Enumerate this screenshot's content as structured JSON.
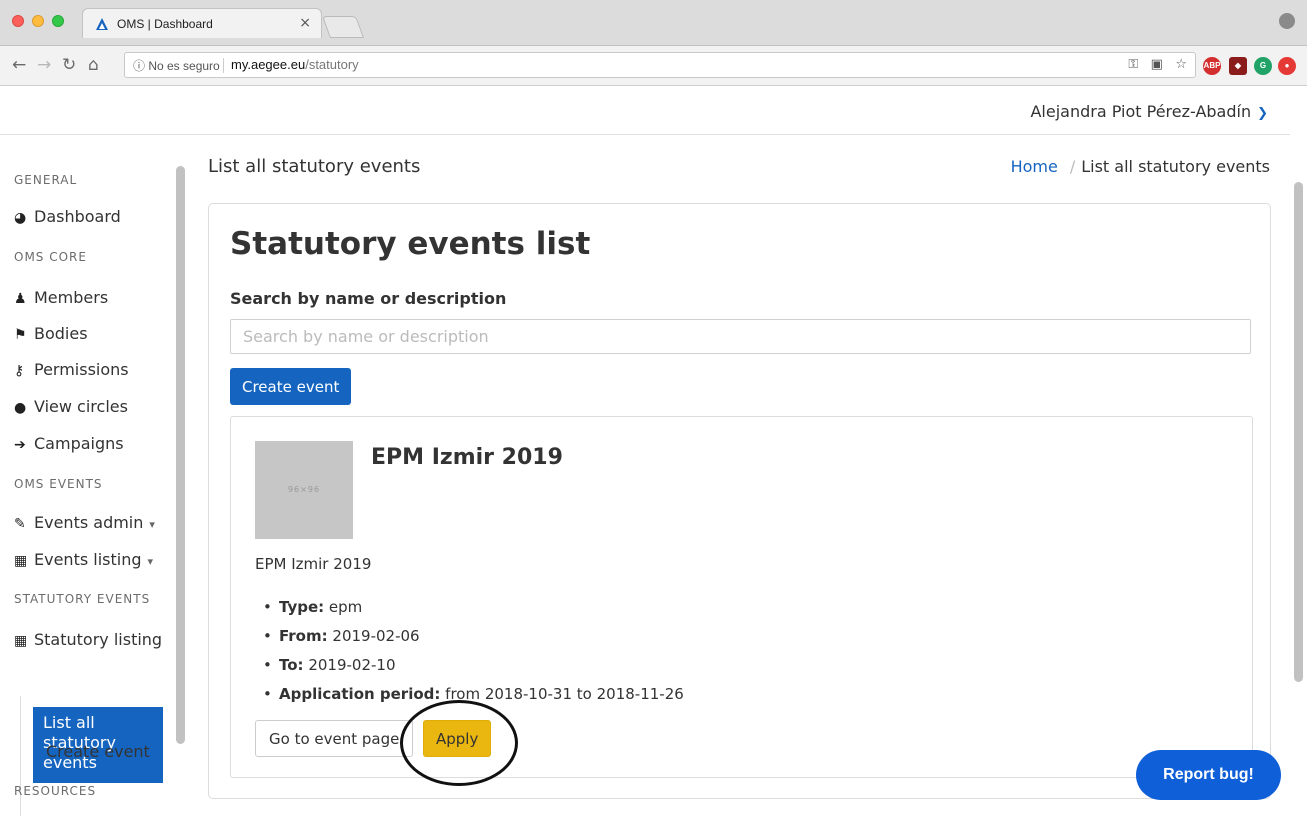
{
  "browser": {
    "tab_title": "OMS | Dashboard",
    "tab_close": "×",
    "omnibox_security": "ⓘ No es seguro",
    "url_host": "my.aegee.eu",
    "url_path": "/statutory"
  },
  "topbar": {
    "user_name": "Alejandra Piot Pérez-Abadín"
  },
  "sidebar": {
    "general_heading": "GENERAL",
    "dashboard": "Dashboard",
    "core_heading": "OMS CORE",
    "members": "Members",
    "bodies": "Bodies",
    "permissions": "Permissions",
    "view_circles": "View circles",
    "campaigns": "Campaigns",
    "events_heading": "OMS EVENTS",
    "events_admin": "Events admin",
    "events_listing": "Events listing",
    "statutory_heading": "STATUTORY EVENTS",
    "statutory_listing": "Statutory listing",
    "list_all": "List all statutory events",
    "create_event": "Create event",
    "resources_heading": "RESOURCES"
  },
  "content": {
    "header": "List all statutory events",
    "breadcrumb_home": "Home",
    "breadcrumb_current": "List all statutory events"
  },
  "card": {
    "title": "Statutory events list",
    "search_label": "Search by name or description",
    "search_placeholder": "Search by name or description",
    "search_value": "",
    "create_button": "Create event"
  },
  "event": {
    "thumb_label": "96×96",
    "title": "EPM Izmir 2019",
    "description": "EPM Izmir 2019",
    "details": [
      {
        "label": "Type:",
        "value": "epm"
      },
      {
        "label": "From:",
        "value": "2019-02-06"
      },
      {
        "label": "To:",
        "value": "2019-02-10"
      },
      {
        "label": "Application period:",
        "value": "from 2018-10-31 to 2018-11-26"
      }
    ],
    "goto_button": "Go to event page",
    "apply_button": "Apply"
  },
  "report_bug": "Report bug!",
  "colors": {
    "primary": "#1565c0",
    "apply": "#eab610",
    "report": "#0f5fd8"
  }
}
